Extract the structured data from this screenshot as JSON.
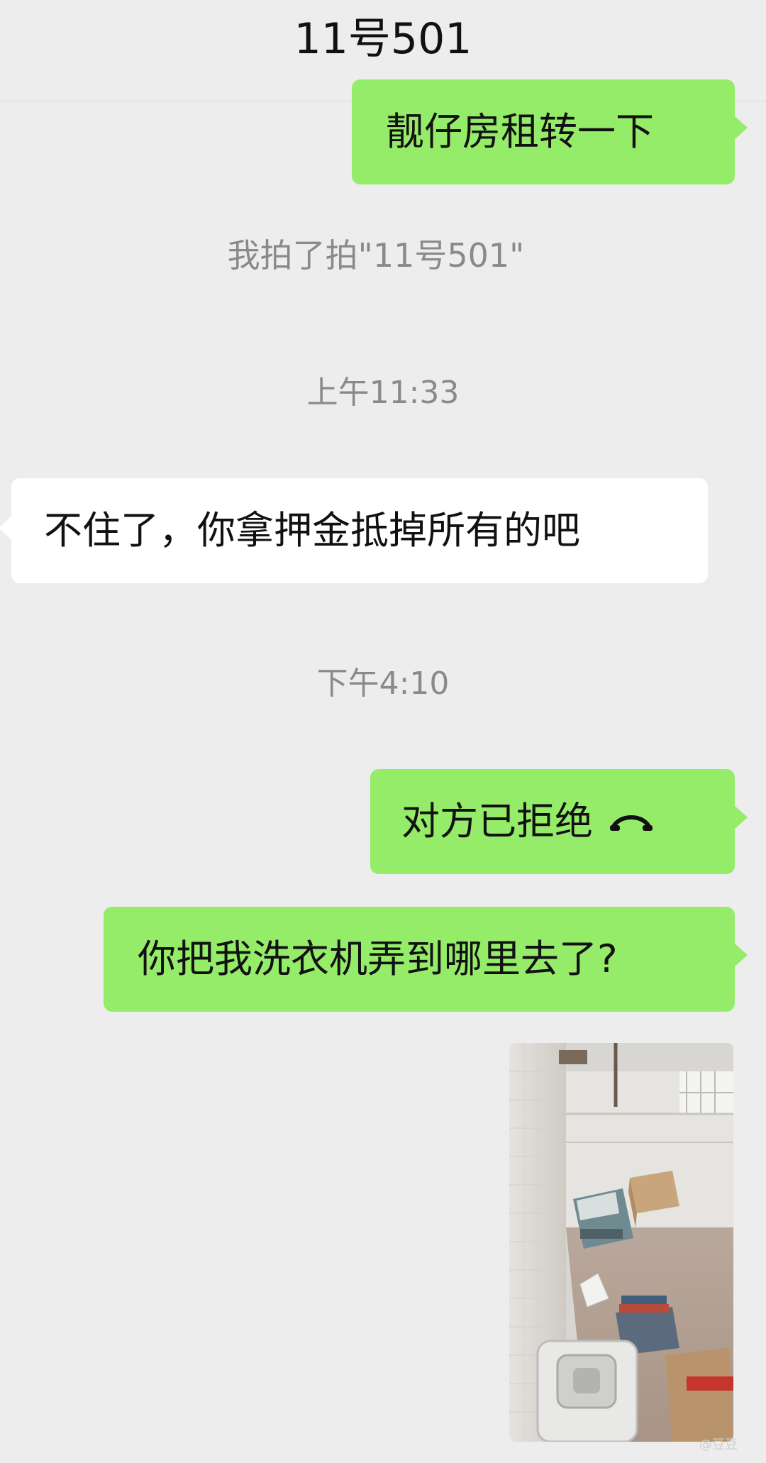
{
  "header": {
    "title": "11号501"
  },
  "messages": [
    {
      "type": "outgoing_text",
      "text": "靓仔房租转一下"
    },
    {
      "type": "system",
      "text": "我拍了拍\"11号501\""
    },
    {
      "type": "timestamp",
      "text": "上午11:33"
    },
    {
      "type": "incoming_text",
      "text": "不住了，你拿押金抵掉所有的吧"
    },
    {
      "type": "timestamp",
      "text": "下午4:10"
    },
    {
      "type": "outgoing_call",
      "text": "对方已拒绝",
      "icon": "phone-hangup-icon"
    },
    {
      "type": "outgoing_text",
      "text": "你把我洗衣机弄到哪里去了?"
    },
    {
      "type": "outgoing_image"
    }
  ],
  "watermark": "@豆豆"
}
